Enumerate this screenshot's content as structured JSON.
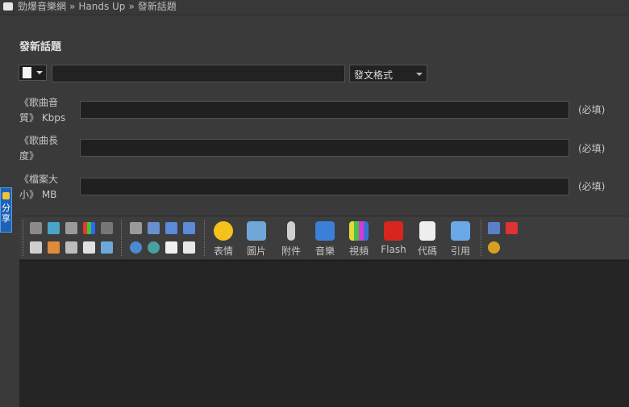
{
  "breadcrumb": {
    "site": "勁爆音樂網",
    "separator": "»",
    "forum": "Hands Up",
    "current": "發新話題"
  },
  "page": {
    "title": "發新話題"
  },
  "form": {
    "subject_value": "",
    "format_select": {
      "selected": "發文格式"
    },
    "fields": [
      {
        "label_line1": "《歌曲音",
        "label_line2": "質》 Kbps",
        "value": "",
        "required": "(必填)"
      },
      {
        "label_line1": "《歌曲長",
        "label_line2": "度》",
        "value": "",
        "required": "(必填)"
      },
      {
        "label_line1": "《檔案大",
        "label_line2": "小》 MB",
        "value": "",
        "required": "(必填)"
      }
    ]
  },
  "share": {
    "line1": "分",
    "line2": "享"
  },
  "toolbar": {
    "big_buttons": [
      {
        "label": "表情",
        "icon": "smiley-icon",
        "color": "#f5c21b"
      },
      {
        "label": "圖片",
        "icon": "image-icon",
        "color": "#6fa8d8"
      },
      {
        "label": "附件",
        "icon": "paperclip-icon",
        "color": "#cfcfcf"
      },
      {
        "label": "音樂",
        "icon": "music-note-icon",
        "color": "#3b7fd9"
      },
      {
        "label": "視頻",
        "icon": "video-icon",
        "color": "#7cbf3a"
      },
      {
        "label": "Flash",
        "icon": "flash-icon",
        "color": "#d8261f"
      },
      {
        "label": "代碼",
        "icon": "code-icon",
        "color": "#eeeeee"
      },
      {
        "label": "引用",
        "icon": "quote-icon",
        "color": "#6aa8e8"
      }
    ]
  },
  "editor": {
    "content": ""
  }
}
